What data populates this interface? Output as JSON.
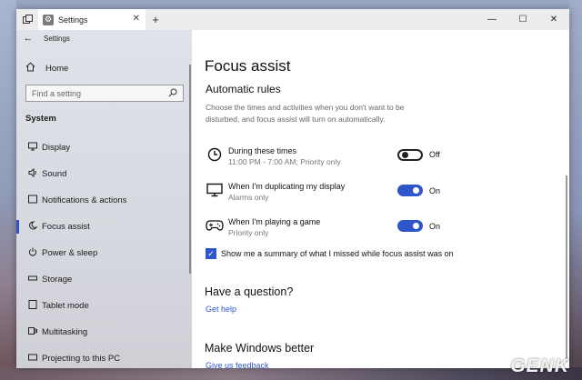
{
  "window": {
    "tab_title": "Settings",
    "tab_close": "✕",
    "new_tab": "+",
    "controls": {
      "minimize": "—",
      "maximize": "☐",
      "close": "✕"
    }
  },
  "sidebar": {
    "app_title": "Settings",
    "home_label": "Home",
    "search_placeholder": "Find a setting",
    "section_label": "System",
    "items": [
      {
        "label": "Display",
        "icon": "monitor-icon"
      },
      {
        "label": "Sound",
        "icon": "speaker-icon"
      },
      {
        "label": "Notifications & actions",
        "icon": "notification-icon"
      },
      {
        "label": "Focus assist",
        "icon": "moon-icon",
        "active": true
      },
      {
        "label": "Power & sleep",
        "icon": "power-icon"
      },
      {
        "label": "Storage",
        "icon": "storage-icon"
      },
      {
        "label": "Tablet mode",
        "icon": "tablet-icon"
      },
      {
        "label": "Multitasking",
        "icon": "multitasking-icon"
      },
      {
        "label": "Projecting to this PC",
        "icon": "projector-icon"
      }
    ]
  },
  "main": {
    "title": "Focus assist",
    "subtitle": "Automatic rules",
    "description": "Choose the times and activities when you don't want to be disturbed, and focus assist will turn on automatically.",
    "rules": [
      {
        "title": "During these times",
        "sub": "11:00 PM - 7:00 AM; Priority only",
        "state": "Off",
        "on": false,
        "icon": "clock-icon"
      },
      {
        "title": "When I'm duplicating my display",
        "sub": "Alarms only",
        "state": "On",
        "on": true,
        "icon": "display-icon"
      },
      {
        "title": "When I'm playing a game",
        "sub": "Priority only",
        "state": "On",
        "on": true,
        "icon": "gamepad-icon"
      }
    ],
    "checkbox_label": "Show me a summary of what I missed while focus assist was on",
    "question_heading": "Have a question?",
    "help_link": "Get help",
    "better_heading": "Make Windows better",
    "feedback_link": "Give us feedback"
  },
  "watermark": "GENK",
  "colors": {
    "accent": "#2f56c8"
  }
}
